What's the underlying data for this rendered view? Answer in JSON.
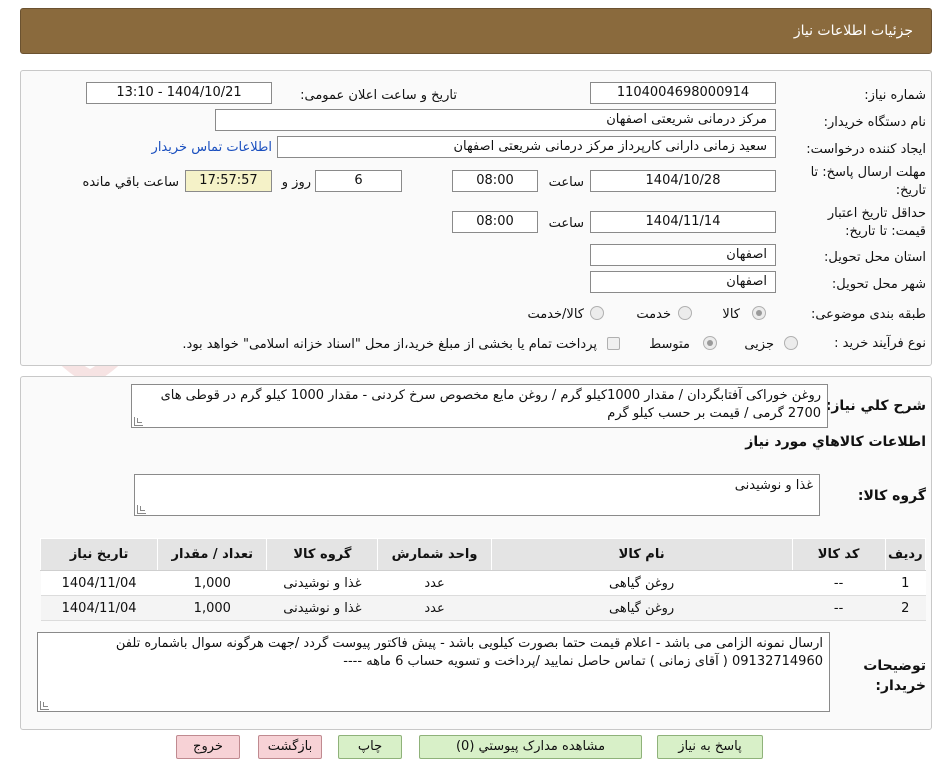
{
  "header": {
    "title": "جزئیات اطلاعات نیاز"
  },
  "watermark": {
    "text": "AriaTender.net"
  },
  "info": {
    "need_number_label": "شماره نیاز:",
    "need_number": "1104004698000914",
    "announce_label": "تاریخ و ساعت اعلان عمومی:",
    "announce_value": "1404/10/21 - 13:10",
    "buyer_org_label": "نام دستگاه خریدار:",
    "buyer_org": "مرکز درمانی شریعتی اصفهان",
    "requester_label": "ایجاد کننده درخواست:",
    "requester": "سعید زمانی دارانی کارپرداز مرکز درمانی شریعتی اصفهان",
    "contact_link": "اطلاعات تماس خریدار",
    "deadline_label_1": "مهلت ارسال پاسخ: تا",
    "deadline_label_2": "تاریخ:",
    "deadline_date": "1404/10/28",
    "time_word": "ساعت",
    "deadline_time": "08:00",
    "days_value": "6",
    "days_word": "روز و",
    "remaining_time": "17:57:57",
    "remaining_word": "ساعت باقي مانده",
    "validity_label_1": "حداقل تاریخ اعتبار",
    "validity_label_2": "قیمت: تا تاریخ:",
    "validity_date": "1404/11/14",
    "validity_time": "08:00",
    "province_label": "استان محل تحویل:",
    "province": "اصفهان",
    "city_label": "شهر محل تحویل:",
    "city": "اصفهان",
    "category_label": "طبقه بندی موضوعی:",
    "category_options": [
      "کالا",
      "خدمت",
      "کالا/خدمت"
    ],
    "purchase_type_label": "نوع فرآیند خرید :",
    "purchase_options": [
      "جزیی",
      "متوسط"
    ],
    "purchase_note": "پرداخت تمام یا بخشی از مبلغ خرید،از محل \"اسناد خزانه اسلامی\" خواهد بود."
  },
  "summary": {
    "label": "شرح کلي نياز:",
    "text": "روغن خوراکی آفتابگردان / مقدار 1000کیلو گرم / روغن مایع مخصوص سرخ کردنی - مقدار 1000 کیلو گرم در قوطی های 2700 گرمی / قیمت بر حسب کیلو گرم"
  },
  "goods": {
    "section_title": "اطلاعات کالاهاي مورد نياز",
    "group_label": "گروه کالا:",
    "group_value": "غذا و نوشیدنی",
    "table": {
      "headers": [
        "رديف",
        "کد کالا",
        "نام کالا",
        "واحد شمارش",
        "گروه کالا",
        "تعداد / مقدار",
        "تاريخ نياز"
      ],
      "rows": [
        [
          "1",
          "--",
          "روغن گیاهی",
          "عدد",
          "غذا و نوشیدنی",
          "1,000",
          "1404/11/04"
        ],
        [
          "2",
          "--",
          "روغن گیاهی",
          "عدد",
          "غذا و نوشیدنی",
          "1,000",
          "1404/11/04"
        ]
      ]
    }
  },
  "buyer_notes": {
    "label_1": "توضیحات",
    "label_2": "خریدار:",
    "text": "ارسال نمونه الزامی می باشد - اعلام قیمت حتما بصورت کیلویی باشد -  پیش فاکتور پیوست گردد /جهت هرگونه سوال باشماره تلفن 09132714960 ( آقای زمانی ) تماس حاصل نمایید /پرداخت و تسویه حساب 6 ماهه ----"
  },
  "buttons": {
    "reply": "پاسخ به نیاز",
    "attachments": "مشاهده مدارک پیوستي (0)",
    "print": "چاپ",
    "back": "بازگشت",
    "exit": "خروج"
  },
  "colors": {
    "header": "#8a6a3d",
    "link": "#1a4fbf",
    "green_button": "#d8f0c8",
    "pink_button": "#f7d2d6"
  }
}
